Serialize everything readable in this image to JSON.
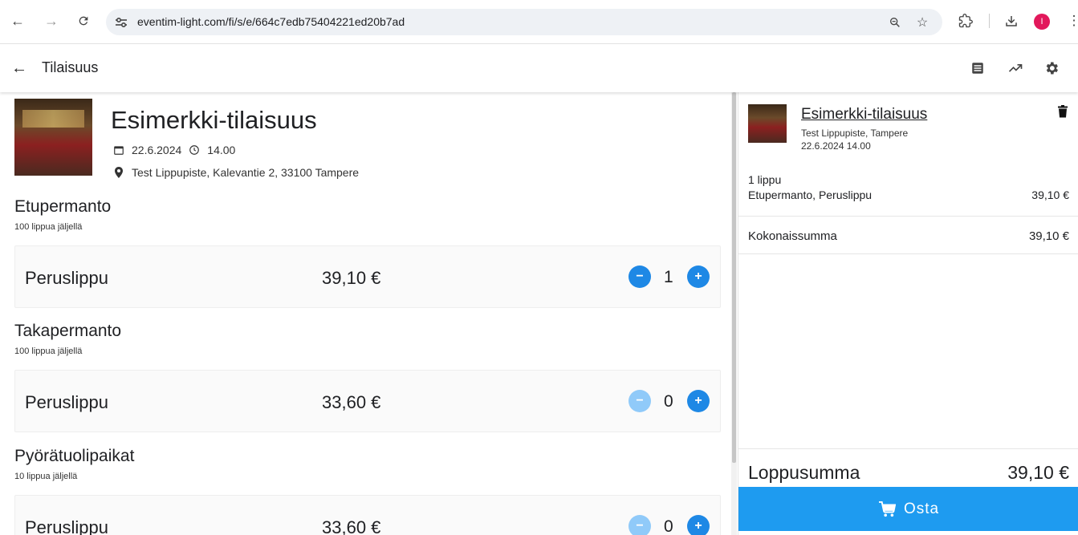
{
  "browser": {
    "url": "eventim-light.com/fi/s/e/664c7edb75404221ed20b7ad",
    "profile_initial": "I"
  },
  "appbar": {
    "title": "Tilaisuus"
  },
  "event": {
    "title": "Esimerkki-tilaisuus",
    "date": "22.6.2024",
    "time": "14.00",
    "location": "Test Lippupiste, Kalevantie 2, 33100 Tampere"
  },
  "sections": [
    {
      "title": "Etupermanto",
      "availability": "100 lippua jäljellä",
      "ticket": {
        "name": "Peruslippu",
        "price": "39,10 €",
        "quantity": "1"
      }
    },
    {
      "title": "Takapermanto",
      "availability": "100 lippua jäljellä",
      "ticket": {
        "name": "Peruslippu",
        "price": "33,60 €",
        "quantity": "0"
      }
    },
    {
      "title": "Pyörätuolipaikat",
      "availability": "10 lippua jäljellä",
      "ticket": {
        "name": "Peruslippu",
        "price": "33,60 €",
        "quantity": "0"
      }
    }
  ],
  "cart": {
    "event_title": "Esimerkki-tilaisuus",
    "venue": "Test Lippupiste, Tampere",
    "datetime": "22.6.2024 14.00",
    "count": "1 lippu",
    "line_label": "Etupermanto, Peruslippu",
    "line_price": "39,10 €",
    "total_label": "Kokonaissumma",
    "total_value": "39,10 €",
    "final_label": "Loppusumma",
    "final_value": "39,10 €",
    "buy_label": "Osta"
  },
  "colors": {
    "accent": "#1e88e5",
    "buy_button": "#1e9bf0",
    "disabled": "#90caf9",
    "profile": "#e2185b"
  }
}
